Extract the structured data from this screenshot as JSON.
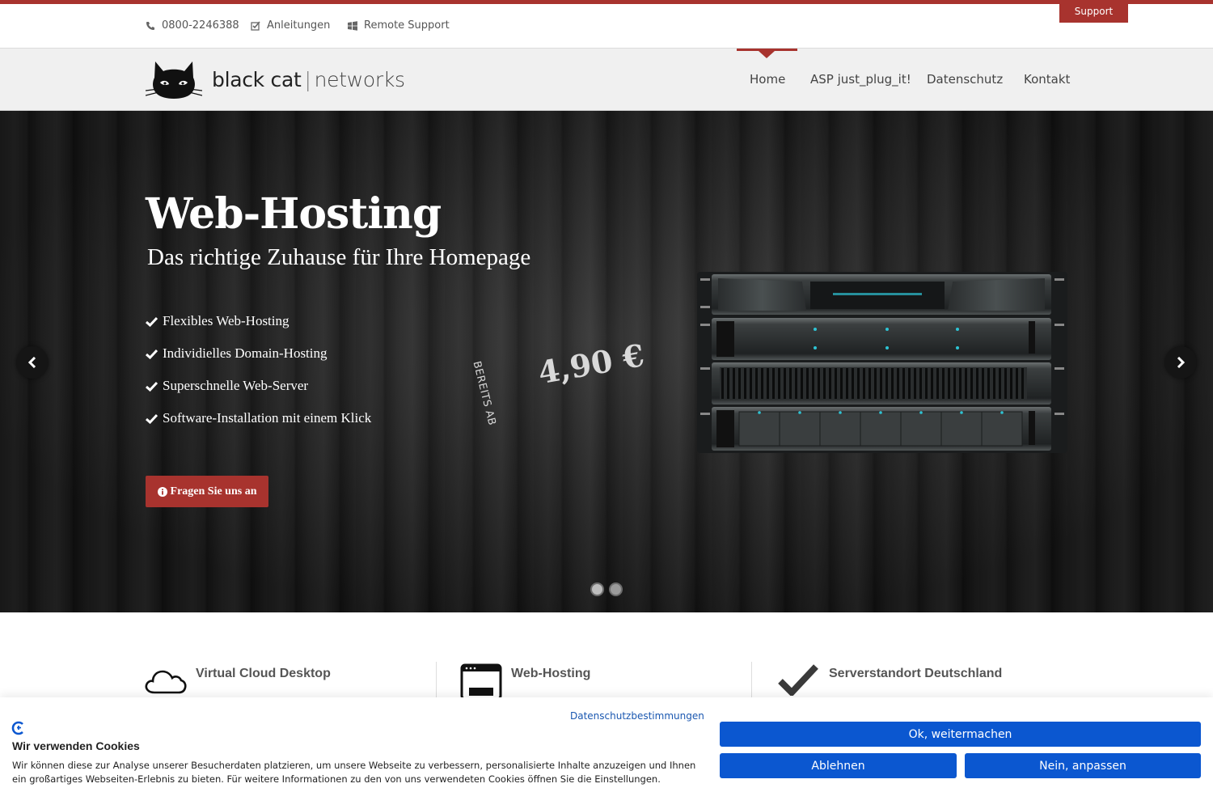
{
  "topbar": {
    "phone": "0800-2246388",
    "guides": "Anleitungen",
    "remote": "Remote Support",
    "support_tab": "Support"
  },
  "logo": {
    "brand_main": "black cat",
    "brand_sep": "|",
    "brand_sub": "networks"
  },
  "nav": {
    "items": [
      "Home",
      "ASP just_plug_it!",
      "Datenschutz",
      "Kontakt"
    ],
    "active": "Home"
  },
  "hero": {
    "title": "Web-Hosting",
    "subtitle": "Das richtige Zuhause für Ihre Homepage",
    "features": [
      "Flexibles Web-Hosting",
      "Individielles Domain-Hosting",
      "Superschnelle Web-Server",
      "Software-Installation mit einem Klick"
    ],
    "cta": "Fragen Sie uns an",
    "price_prefix": "BEREITS AB",
    "price": "4,90 €",
    "slide_count": 2,
    "active_slide": 1
  },
  "features_row": [
    {
      "title": "Virtual Cloud Desktop",
      "icon": "cloud-icon"
    },
    {
      "title": "Web-Hosting",
      "icon": "browser-window-icon"
    },
    {
      "title": "Serverstandort Deutschland",
      "icon": "checkmark-icon"
    }
  ],
  "cookie": {
    "policy_link": "Datenschutzbestimmungen",
    "title": "Wir verwenden Cookies",
    "text": "Wir können diese zur Analyse unserer Besucherdaten platzieren, um unsere Webseite zu verbessern, personalisierte Inhalte anzuzeigen und Ihnen ein großartiges Webseiten-Erlebnis zu bieten. Für weitere Informationen zu den von uns verwendeten Cookies öffnen Sie die Einstellungen.",
    "accept": "Ok, weitermachen",
    "decline": "Ablehnen",
    "customize": "Nein, anpassen"
  },
  "colors": {
    "brand_red": "#a8332e",
    "cookie_blue": "#0b57d0"
  }
}
